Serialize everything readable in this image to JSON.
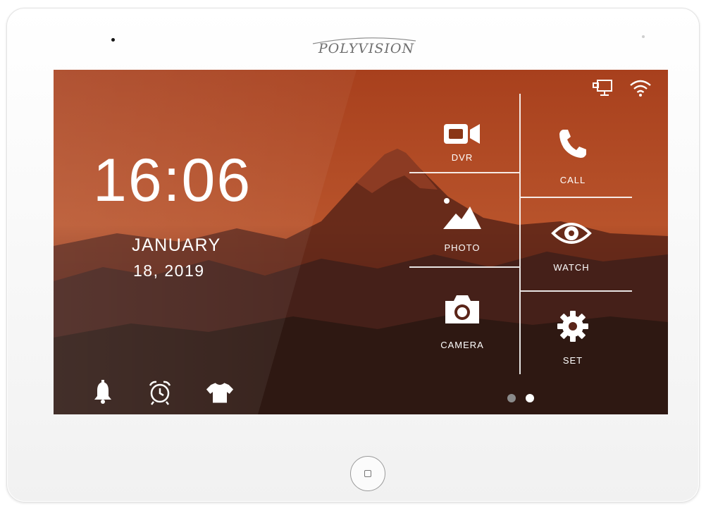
{
  "device": {
    "brand": "POLYVISION",
    "home_button_icon": "home-button-square",
    "bezel_color": "#ffffff"
  },
  "home_screen": {
    "time": "16:06",
    "date_month": "JANUARY",
    "date_day": "18, 2019",
    "wallpaper_colors": [
      "#b8502a",
      "#8a2e12",
      "#3a1a12"
    ],
    "status_icons": [
      "network-icon",
      "wifi-icon"
    ],
    "quick_icons": [
      "bell-icon",
      "alarm-clock-icon",
      "shirt-icon"
    ]
  },
  "menu": {
    "tiles": [
      {
        "id": "dvr",
        "label": "DVR",
        "icon": "video-camera-icon"
      },
      {
        "id": "call",
        "label": "CALL",
        "icon": "phone-icon"
      },
      {
        "id": "photo",
        "label": "PHOTO",
        "icon": "landscape-icon"
      },
      {
        "id": "watch",
        "label": "WATCH",
        "icon": "eye-icon"
      },
      {
        "id": "camera",
        "label": "CAMERA",
        "icon": "camera-icon"
      },
      {
        "id": "set",
        "label": "SET",
        "icon": "gear-icon"
      }
    ]
  },
  "pagination": {
    "total_pages": 2,
    "current_page": 2,
    "active_color": "#ffffff",
    "inactive_color": "#8a8a8a"
  }
}
